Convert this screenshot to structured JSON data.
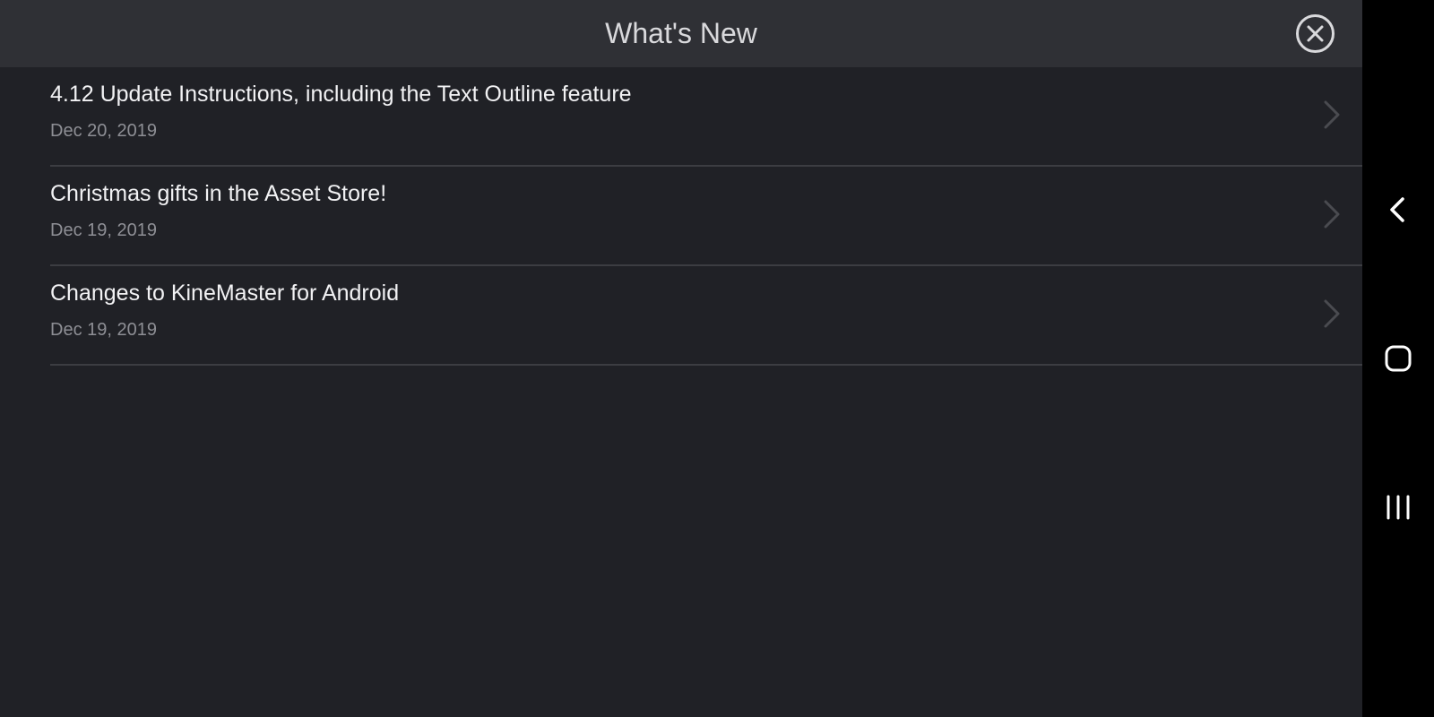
{
  "header": {
    "title": "What's New",
    "close_icon": "close-circle-icon"
  },
  "news": [
    {
      "title": "4.12 Update Instructions, including the Text Outline feature",
      "date": "Dec 20, 2019"
    },
    {
      "title": "Christmas gifts in the Asset Store!",
      "date": "Dec 19, 2019"
    },
    {
      "title": "Changes to KineMaster for Android",
      "date": "Dec 19, 2019"
    }
  ],
  "navbar": {
    "items": [
      "back-icon",
      "home-icon",
      "recents-icon"
    ]
  },
  "colors": {
    "background": "#202126",
    "header": "#2f3035",
    "title_text": "#f2f2f4",
    "date_text": "#8e8f95",
    "navbar": "#000000"
  }
}
